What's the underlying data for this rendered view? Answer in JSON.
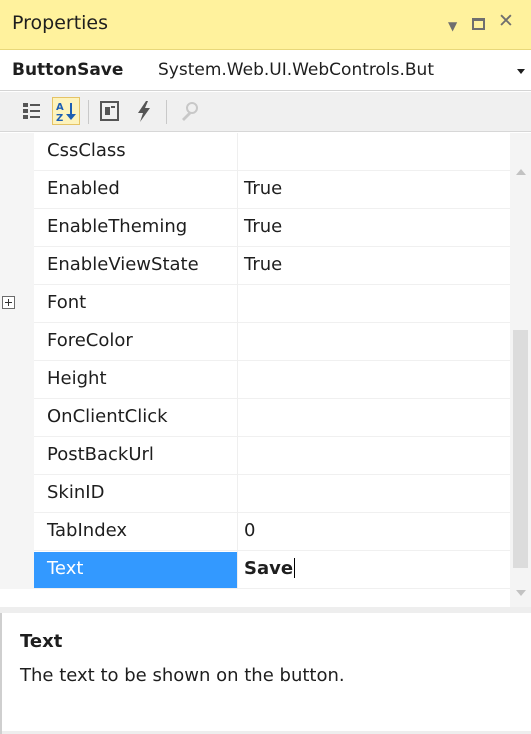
{
  "titlebar": {
    "title": "Properties"
  },
  "object_selector": {
    "name": "ButtonSave",
    "type": "System.Web.UI.WebControls.But"
  },
  "toolbar": {
    "buttons": [
      {
        "icon": "categorized-icon",
        "active": false
      },
      {
        "icon": "alphabetical-sort-icon",
        "active": true
      },
      {
        "icon": "properties-icon",
        "active": false
      },
      {
        "icon": "events-lightning-icon",
        "active": false
      },
      {
        "icon": "property-pages-wrench-icon",
        "active": false
      }
    ]
  },
  "properties": [
    {
      "name": "CssClass",
      "value": ""
    },
    {
      "name": "Enabled",
      "value": "True"
    },
    {
      "name": "EnableTheming",
      "value": "True"
    },
    {
      "name": "EnableViewState",
      "value": "True"
    },
    {
      "name": "Font",
      "value": "",
      "expandable": true
    },
    {
      "name": "ForeColor",
      "value": ""
    },
    {
      "name": "Height",
      "value": ""
    },
    {
      "name": "OnClientClick",
      "value": ""
    },
    {
      "name": "PostBackUrl",
      "value": ""
    },
    {
      "name": "SkinID",
      "value": ""
    },
    {
      "name": "TabIndex",
      "value": "0"
    },
    {
      "name": "Text",
      "value": "Save",
      "selected": true
    }
  ],
  "description": {
    "title": "Text",
    "text": "The text to be shown on the button."
  },
  "colors": {
    "titlebar_bg": "#fff29d",
    "selection": "#3399ff"
  }
}
